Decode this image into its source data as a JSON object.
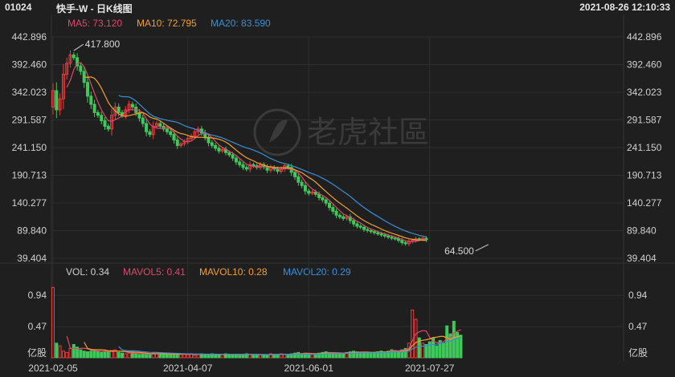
{
  "header": {
    "code": "01024",
    "name": "快手-W - 日K线图",
    "datetime": "2021-08-26 12:10:33"
  },
  "watermark": "老虎社區",
  "price_legend": [
    {
      "label": "MA5: 73.120",
      "color": "#e0476a"
    },
    {
      "label": "MA10: 72.795",
      "color": "#f0a030"
    },
    {
      "label": "MA20: 83.590",
      "color": "#3a8fd8"
    }
  ],
  "volume_legend": [
    {
      "label": "VOL: 0.34",
      "color": "#cfcfcf"
    },
    {
      "label": "MAVOL5: 0.41",
      "color": "#e0476a"
    },
    {
      "label": "MAVOL10: 0.28",
      "color": "#f0a030"
    },
    {
      "label": "MAVOL20: 0.29",
      "color": "#3a8fd8"
    }
  ],
  "colors": {
    "up": "#ef3b3b",
    "down": "#3ec95a",
    "grid": "#2e2e2e",
    "ma5": "#e0476a",
    "ma10": "#f0a030",
    "ma20": "#3a8fd8"
  },
  "chart_data": {
    "type": "candlestick",
    "price_axis": {
      "ticks": [
        442.896,
        392.46,
        342.023,
        291.587,
        241.15,
        190.713,
        140.277,
        89.84,
        39.404
      ],
      "tick_labels": [
        "442.896",
        "392.460",
        "342.023",
        "291.587",
        "241.150",
        "190.713",
        "140.277",
        "89.840",
        "39.404"
      ]
    },
    "volume_axis": {
      "unit": "亿股",
      "ticks": [
        0.94,
        0.47
      ],
      "tick_labels": [
        "0.94",
        "0.47"
      ],
      "max": 1.1
    },
    "date_labels": [
      "2021-02-05",
      "2021-04-07",
      "2021-06-01",
      "2021-07-27"
    ],
    "date_label_index": [
      0,
      39,
      74,
      109
    ],
    "annotations": {
      "high": {
        "label": "417.800",
        "value": 417.8,
        "index": 6
      },
      "low": {
        "label": "64.500",
        "value": 64.5,
        "index": 126
      }
    },
    "close": [
      345,
      310,
      330,
      375,
      395,
      410,
      405,
      390,
      380,
      360,
      335,
      320,
      305,
      300,
      290,
      280,
      275,
      300,
      315,
      305,
      300,
      310,
      320,
      315,
      305,
      295,
      285,
      270,
      265,
      280,
      285,
      280,
      275,
      270,
      265,
      255,
      245,
      248,
      252,
      258,
      262,
      270,
      275,
      268,
      260,
      250,
      245,
      240,
      235,
      238,
      232,
      228,
      222,
      215,
      210,
      205,
      202,
      210,
      208,
      205,
      210,
      206,
      200,
      205,
      202,
      198,
      202,
      208,
      205,
      196,
      188,
      178,
      172,
      162,
      158,
      160,
      156,
      150,
      146,
      140,
      132,
      125,
      118,
      115,
      112,
      115,
      108,
      102,
      98,
      96,
      92,
      90,
      88,
      86,
      84,
      82,
      80,
      78,
      76,
      75,
      72,
      68,
      66,
      70,
      72,
      75,
      74,
      76,
      73
    ],
    "volume": [
      1.06,
      0.22,
      0.18,
      0.1,
      0.08,
      0.14,
      0.2,
      0.16,
      0.12,
      0.1,
      0.09,
      0.1,
      0.12,
      0.1,
      0.08,
      0.09,
      0.1,
      0.11,
      0.12,
      0.08,
      0.07,
      0.06,
      0.07,
      0.08,
      0.06,
      0.05,
      0.06,
      0.05,
      0.06,
      0.07,
      0.06,
      0.06,
      0.05,
      0.06,
      0.05,
      0.04,
      0.06,
      0.05,
      0.06,
      0.05,
      0.06,
      0.04,
      0.05,
      0.06,
      0.04,
      0.05,
      0.06,
      0.05,
      0.04,
      0.05,
      0.06,
      0.05,
      0.04,
      0.05,
      0.04,
      0.05,
      0.06,
      0.05,
      0.04,
      0.05,
      0.04,
      0.05,
      0.04,
      0.06,
      0.05,
      0.05,
      0.06,
      0.05,
      0.04,
      0.06,
      0.07,
      0.08,
      0.06,
      0.07,
      0.06,
      0.05,
      0.06,
      0.07,
      0.08,
      0.09,
      0.08,
      0.07,
      0.06,
      0.07,
      0.06,
      0.08,
      0.09,
      0.1,
      0.09,
      0.08,
      0.09,
      0.08,
      0.07,
      0.08,
      0.09,
      0.1,
      0.09,
      0.1,
      0.12,
      0.11,
      0.1,
      0.12,
      0.14,
      0.22,
      0.72,
      0.58,
      0.3,
      0.22,
      0.2,
      0.24,
      0.3,
      0.18,
      0.26,
      0.22,
      0.48,
      0.36,
      0.55,
      0.38,
      0.34
    ]
  }
}
